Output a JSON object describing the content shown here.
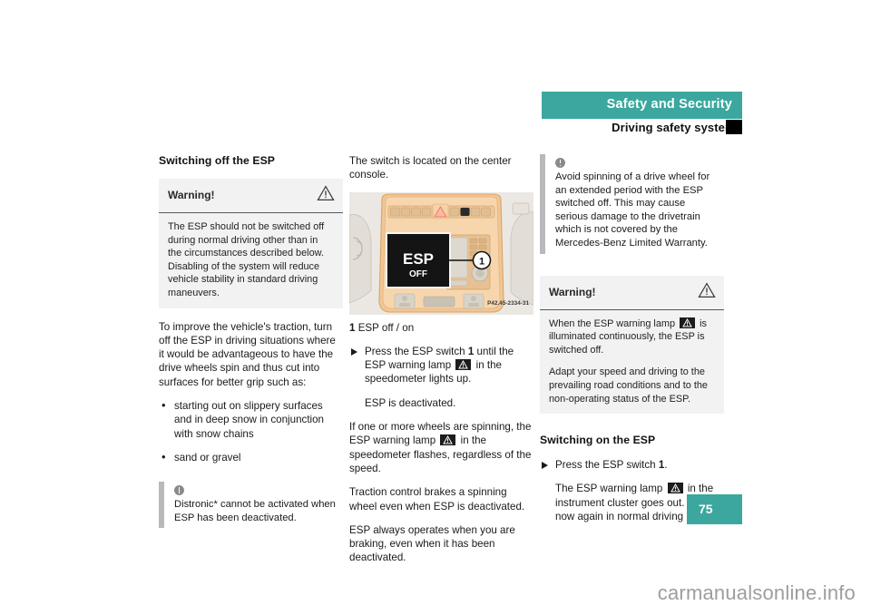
{
  "header": {
    "chapter_title": "Safety and Security",
    "section_title": "Driving safety systems"
  },
  "page_number": "75",
  "watermark": "carmanualsonline.info",
  "colors": {
    "accent_teal": "#3ba79e",
    "warning_box_bg": "#f2f2f2",
    "info_bar": "#b9b9b9",
    "text": "#1a1a1a"
  },
  "column1": {
    "heading": "Switching off the ESP",
    "warning": {
      "label": "Warning!",
      "icon": "warning-triangle-icon",
      "body": "The ESP should not be switched off during normal driving other than in the circumstances described below. Disabling of the system will reduce vehicle stability in standard driving maneuvers."
    },
    "paragraph": "To improve the vehicle's traction, turn off the ESP in driving situations where it would be advantageous to have the drive wheels spin and thus cut into surfaces for better grip such as:",
    "bullets": [
      "starting out on slippery surfaces and in deep snow in conjunction with snow chains",
      "sand or gravel"
    ],
    "info": {
      "icon": "info-circle-icon",
      "text": "Distronic* cannot be activated when ESP has been deactivated."
    }
  },
  "column2": {
    "intro": "The switch is located on the center console.",
    "figure": {
      "name": "center-console-esp-switch-illustration",
      "display_text_line1": "ESP",
      "display_text_line2": "OFF",
      "callout_number": "1",
      "part_number": "P42.45-2334-31"
    },
    "caption_number": "1",
    "caption_text": "ESP off / on",
    "step1_pre": "Press the ESP switch ",
    "step1_num": "1",
    "step1_mid": " until the ESP warning lamp ",
    "step1_post": " in the speedometer lights up.",
    "substep1": "ESP is deactivated.",
    "para_spin_pre": "If one or more wheels are spinning, the ESP warning lamp ",
    "para_spin_post": " in the speedometer flashes, regardless of the speed.",
    "para_traction": "Traction control brakes a spinning wheel even when ESP is deactivated.",
    "para_braking": "ESP always operates when you are braking, even when it has been deactivated."
  },
  "column3": {
    "info": {
      "icon": "info-exclamation-icon",
      "text": "Avoid spinning of a drive wheel for an extended period with the ESP switched off. This may cause serious damage to the drivetrain which is not covered by the Mercedes-Benz Limited Warranty."
    },
    "warning": {
      "label": "Warning!",
      "icon": "warning-triangle-icon",
      "body_pre": "When the ESP warning lamp ",
      "body_post": " is illuminated continuously, the ESP is switched off.",
      "body2": "Adapt your speed and driving to the prevailing road conditions and to the non-operating status of the ESP."
    },
    "heading": "Switching on the ESP",
    "step1_pre": "Press the ESP switch ",
    "step1_num": "1",
    "step1_post": ".",
    "substep_pre": "The ESP warning lamp ",
    "substep_post": " in the instrument cluster goes out. You are now again in normal driving mode."
  }
}
